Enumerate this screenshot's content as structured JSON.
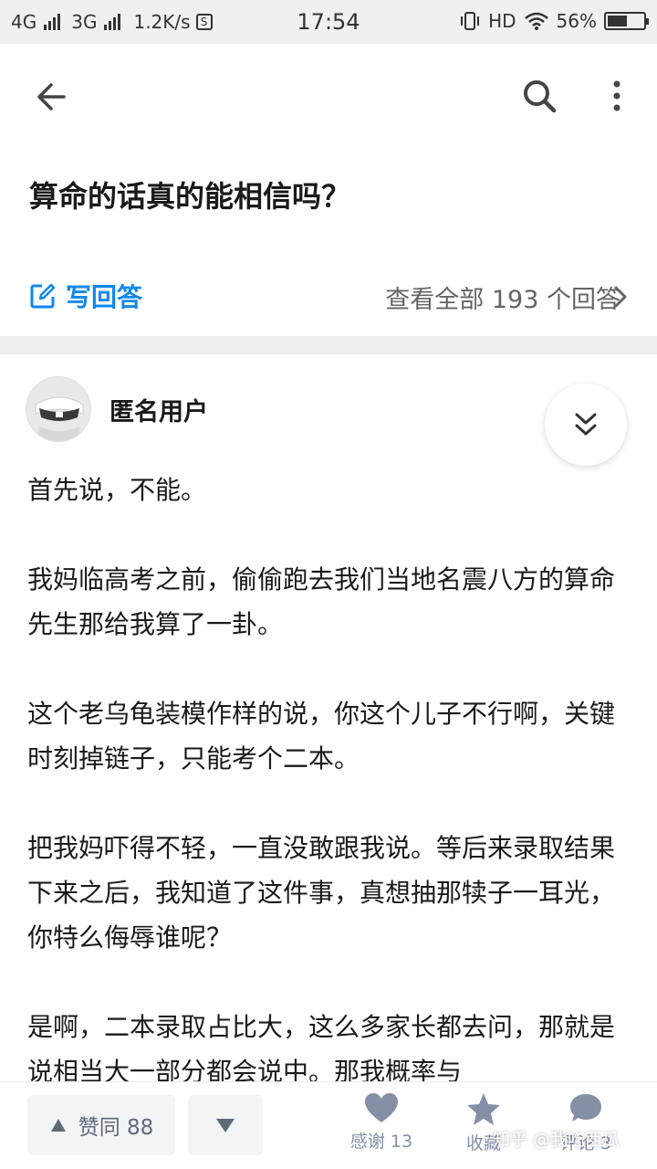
{
  "status_bar": {
    "net1": "4G",
    "net2": "3G",
    "speed": "1.2K/s",
    "time": "17:54",
    "hd": "HD",
    "battery": "56%",
    "battery_level": 0.56
  },
  "question": {
    "title": "算命的话真的能相信吗？"
  },
  "answer_bar": {
    "write_label": "写回答",
    "view_all_label": "查看全部 193 个回答"
  },
  "author": {
    "name": "匿名用户"
  },
  "content": {
    "paragraphs": [
      "首先说，不能。",
      "我妈临高考之前，偷偷跑去我们当地名震八方的算命先生那给我算了一卦。",
      "这个老乌龟装模作样的说，你这个儿子不行啊，关键时刻掉链子，只能考个二本。",
      "把我妈吓得不轻，一直没敢跟我说。等后来录取结果下来之后，我知道了这件事，真想抽那犊子一耳光，你特么侮辱谁呢？",
      "是啊，二本录取占比大，这么多家长都去问，那就是说相当大一部分都会说中。那我概率与"
    ]
  },
  "bottom_bar": {
    "upvote_label": "赞同 88",
    "thanks_label": "感谢 13",
    "collect_label": "收藏",
    "comment_label": "评论 3",
    "watermark": "知乎 @我吃西瓜"
  },
  "colors": {
    "accent": "#0f88eb",
    "muted": "#8590a6"
  }
}
